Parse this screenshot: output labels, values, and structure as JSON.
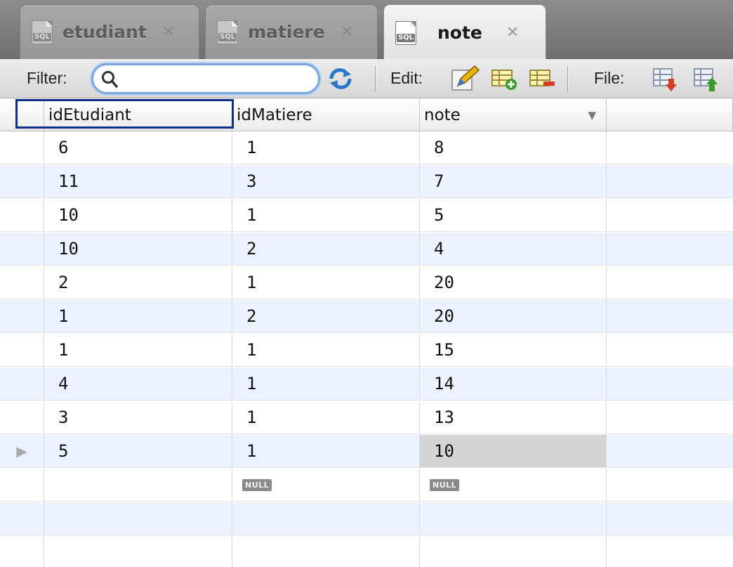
{
  "tabs": [
    {
      "label": "etudiant",
      "icon": "sql-file-icon",
      "icon_text": "SQL",
      "active": false
    },
    {
      "label": "matiere",
      "icon": "sql-file-icon",
      "icon_text": "SQL",
      "active": false
    },
    {
      "label": "note",
      "icon": "sql-file-icon",
      "icon_text": "SQL",
      "active": true
    }
  ],
  "toolbar": {
    "filter_label": "Filter:",
    "filter_value": "",
    "edit_label": "Edit:",
    "file_label": "File:"
  },
  "table": {
    "columns": [
      "idEtudiant",
      "idMatiere",
      "note"
    ],
    "sorted_column": "note",
    "rows": [
      [
        "6",
        "1",
        "8"
      ],
      [
        "11",
        "3",
        "7"
      ],
      [
        "10",
        "1",
        "5"
      ],
      [
        "10",
        "2",
        "4"
      ],
      [
        "2",
        "1",
        "20"
      ],
      [
        "1",
        "2",
        "20"
      ],
      [
        "1",
        "1",
        "15"
      ],
      [
        "4",
        "1",
        "14"
      ],
      [
        "3",
        "1",
        "13"
      ],
      [
        "5",
        "1",
        "10"
      ]
    ],
    "current_row": 9,
    "new_row": [
      "",
      "NULL",
      "NULL"
    ],
    "null_text": "NULL"
  },
  "colors": {
    "focus_border": "#0d2f83",
    "row_alt": "#edf3fe",
    "filter_ring": "#7aa7dd"
  }
}
